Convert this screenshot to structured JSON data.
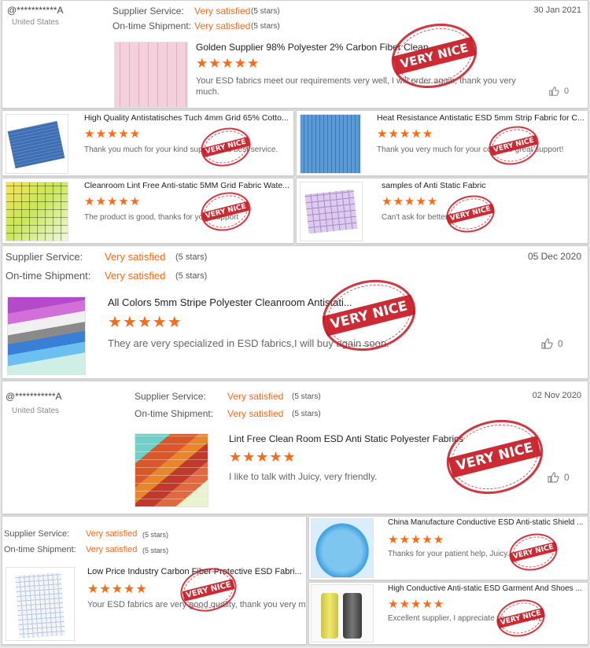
{
  "labels": {
    "supplier_service": "Supplier Service:",
    "ontime_shipment": "On-time Shipment:",
    "satisfied": "Very satisfied",
    "five_stars": "(5 stars)",
    "stamp": "VERY NICE",
    "stars_glyph": "★★★★★"
  },
  "review1": {
    "user": "@***********A",
    "country": "United States",
    "date": "30 Jan 2021",
    "title": "Golden Supplier 98% Polyester 2% Carbon Fiber Clean...",
    "comment_line1": "Your ESD fabrics meet our requirements very well, I will order again, thank you very",
    "comment_line2": "much.",
    "likes": "0"
  },
  "sub1": [
    {
      "title": "High Quality Antistatisches Tuch 4mm Grid 65% Cotto...",
      "comment": "Thank you much for your kind support and best service."
    },
    {
      "title": "Heat Resistance Antistatic ESD 5mm Strip Fabric for C...",
      "comment": "Thank you very much for your continue great support!"
    },
    {
      "title": "Cleanroom Lint Free Anti-static 5MM Grid Fabric Wate...",
      "comment": "The product is good, thanks for your support"
    },
    {
      "title": "samples of Anti Static Fabric",
      "comment": "Can't ask for better"
    }
  ],
  "review2": {
    "date": "05 Dec 2020",
    "title": "All Colors 5mm Stripe Polyester Cleanroom Antistati...",
    "comment": "They are very specialized in ESD fabrics,I will buy again soon.",
    "likes": "0"
  },
  "review3": {
    "user": "@***********A",
    "country": "United States",
    "date": "02 Nov 2020",
    "title": "Lint Free Clean Room ESD Anti Static Polyester Fabrics",
    "comment": "I like to talk with Juicy, very friendly.",
    "likes": "0"
  },
  "review4": {
    "title": "Low Price Industry Carbon Fiber Protective ESD Fabri...",
    "comment": "Your ESD fabrics are very good quality, thank you very much"
  },
  "sub2": [
    {
      "title": "China Manufacture Conductive ESD Anti-static Shield ...",
      "comment": "Thanks for your patient help, Juicy."
    },
    {
      "title": "High Conductive Anti-static ESD Garment And Shoes ...",
      "comment": "Excellent supplier, I appreciate your support."
    }
  ],
  "colors": {
    "accent_orange": "#f26b1d",
    "star": "#ff6a13",
    "stamp_red": "#c8141e"
  }
}
